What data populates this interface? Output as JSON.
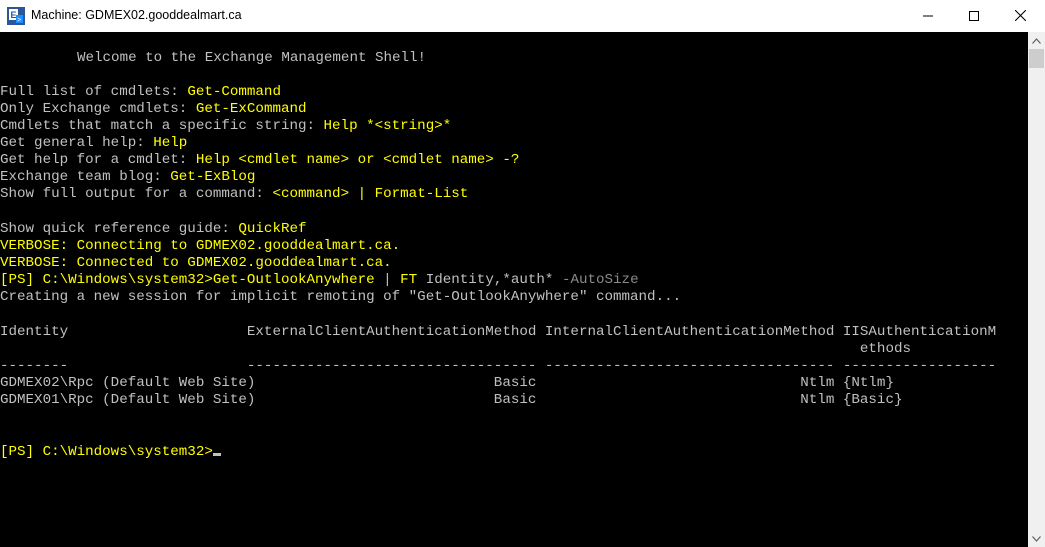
{
  "window": {
    "title": "Machine: GDMEX02.gooddealmart.ca",
    "app_icon": "exchange-shell-icon",
    "buttons": [
      "minimize-icon",
      "maximize-icon",
      "close-icon"
    ]
  },
  "colors": {
    "console_bg": "#000000",
    "text_gray": "#c0c0c0",
    "text_yellow": "#ffff00",
    "param_dim": "#8a8a8a"
  },
  "console": {
    "welcome": "Welcome to the Exchange Management Shell!",
    "help_lines": [
      {
        "label": "Full list of cmdlets: ",
        "value": "Get-Command"
      },
      {
        "label": "Only Exchange cmdlets: ",
        "value": "Get-ExCommand"
      },
      {
        "label": "Cmdlets that match a specific string: ",
        "value": "Help *<string>*"
      },
      {
        "label": "Get general help: ",
        "value": "Help"
      },
      {
        "label": "Get help for a cmdlet: ",
        "value": "Help <cmdlet name> or <cmdlet name> -?"
      },
      {
        "label": "Exchange team blog: ",
        "value": "Get-ExBlog"
      },
      {
        "label": "Show full output for a command: ",
        "value": "<command> | Format-List"
      }
    ],
    "quickref": {
      "label": "Show quick reference guide: ",
      "value": "QuickRef"
    },
    "verbose": [
      "VERBOSE: Connecting to GDMEX02.gooddealmart.ca.",
      "VERBOSE: Connected to GDMEX02.gooddealmart.ca."
    ],
    "prompt": "[PS] C:\\Windows\\system32>",
    "command": {
      "cmdlet": "Get-OutlookAnywhere",
      "pipe": " | ",
      "ft": "FT",
      "args": " Identity,*auth* ",
      "param": "-AutoSize"
    },
    "session_msg": "Creating a new session for implicit remoting of \"Get-OutlookAnywhere\" command...",
    "table": {
      "header_line1": "Identity                     ExternalClientAuthenticationMethod InternalClientAuthenticationMethod IISAuthenticationM",
      "header_line2": "                                                                                                     ethods",
      "separator": "--------                     ---------------------------------- ---------------------------------- ------------------",
      "rows": [
        "GDMEX02\\Rpc (Default Web Site)                            Basic                               Ntlm {Ntlm}",
        "GDMEX01\\Rpc (Default Web Site)                            Basic                               Ntlm {Basic}"
      ]
    },
    "final_prompt": "[PS] C:\\Windows\\system32>"
  }
}
